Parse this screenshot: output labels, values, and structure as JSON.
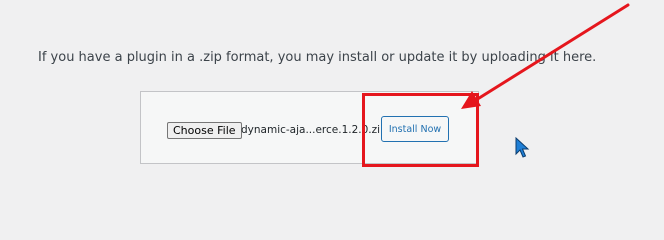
{
  "upload": {
    "intro_text": "If you have a plugin in a .zip format, you may install or update it by uploading it here.",
    "choose_file_label": "Choose File",
    "selected_file": "dynamic-aja...erce.1.2.0.zip",
    "install_label": "Install Now"
  },
  "annotation": {
    "color": "#e5161d"
  },
  "icons": {
    "annotation_arrow": "red-arrow",
    "mouse_cursor": "arrow-pointer"
  }
}
